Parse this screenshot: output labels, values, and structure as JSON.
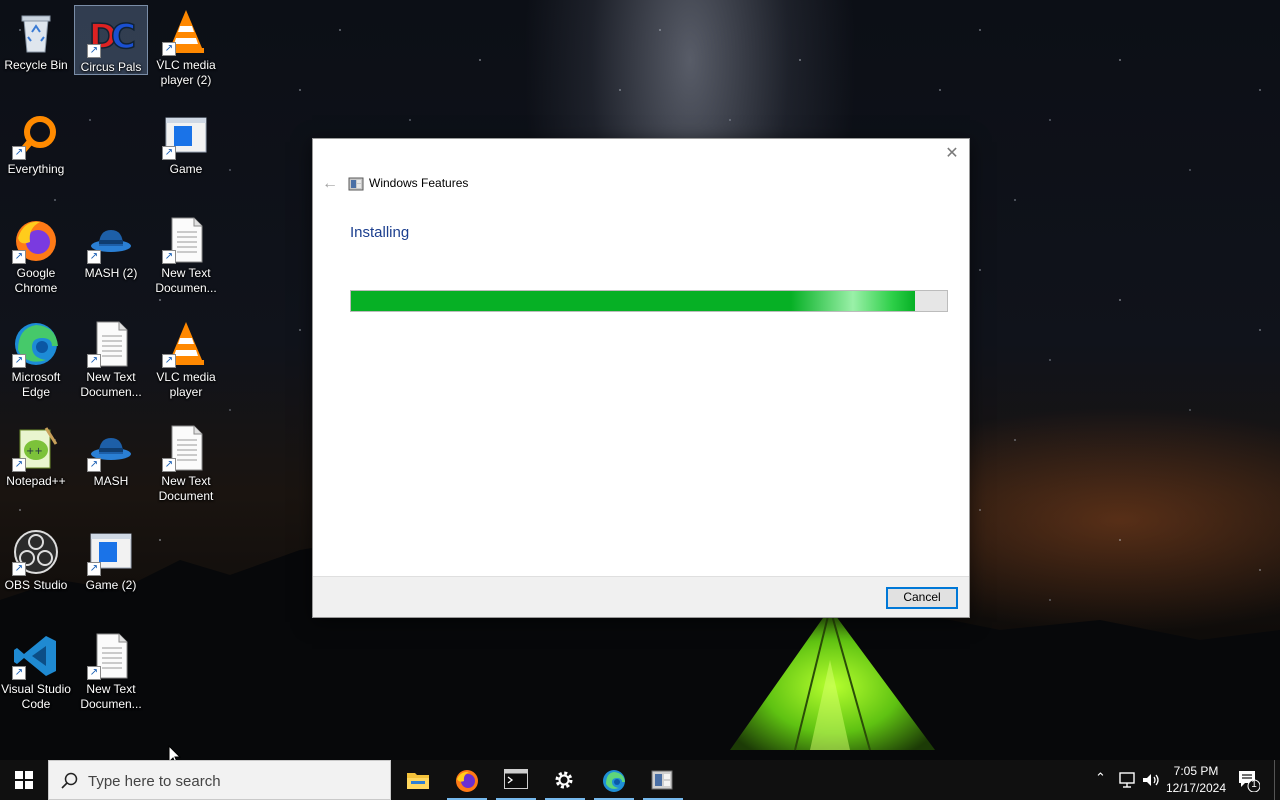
{
  "desktop": {
    "icons": [
      {
        "label": "Recycle Bin",
        "icon": "recycle-bin-icon"
      },
      {
        "label": "Circus Pals",
        "icon": "circus-pals-icon"
      },
      {
        "label": "VLC media player (2)",
        "icon": "vlc-icon"
      },
      {
        "label": "Everything",
        "icon": "everything-search-icon"
      },
      {
        "label": "Game",
        "icon": "game-window-icon"
      },
      {
        "label": "Google Chrome",
        "icon": "firefox-icon"
      },
      {
        "label": "MASH (2)",
        "icon": "mash-hat-icon"
      },
      {
        "label": "New Text Documen...",
        "icon": "text-document-icon"
      },
      {
        "label": "Microsoft Edge",
        "icon": "edge-icon"
      },
      {
        "label": "New Text Documen...",
        "icon": "text-document-icon"
      },
      {
        "label": "VLC media player",
        "icon": "vlc-icon"
      },
      {
        "label": "Notepad++",
        "icon": "notepad-plus-plus-icon"
      },
      {
        "label": "MASH",
        "icon": "mash-hat-icon"
      },
      {
        "label": "New Text Document",
        "icon": "text-document-icon"
      },
      {
        "label": "OBS Studio",
        "icon": "obs-icon"
      },
      {
        "label": "Game (2)",
        "icon": "game-window-icon"
      },
      {
        "label": "Visual Studio Code",
        "icon": "vscode-icon"
      },
      {
        "label": "New Text Documen...",
        "icon": "text-document-icon"
      }
    ]
  },
  "dialog": {
    "title": "Windows Features",
    "heading": "Installing",
    "progress_fraction": 0.947,
    "cancel_label": "Cancel",
    "close_glyph": "✕",
    "back_glyph": "←"
  },
  "taskbar": {
    "search_placeholder": "Type here to search",
    "apps": [
      "file-explorer-icon",
      "firefox-icon",
      "terminal-icon",
      "settings-gear-icon",
      "edge-icon",
      "windows-features-icon"
    ],
    "time": "7:05 PM",
    "date": "12/17/2024",
    "notification_count": "1",
    "accent_color": "#76b9ed"
  },
  "colors": {
    "progress_green": "#06b025",
    "heading_blue": "#1c3f8f"
  }
}
